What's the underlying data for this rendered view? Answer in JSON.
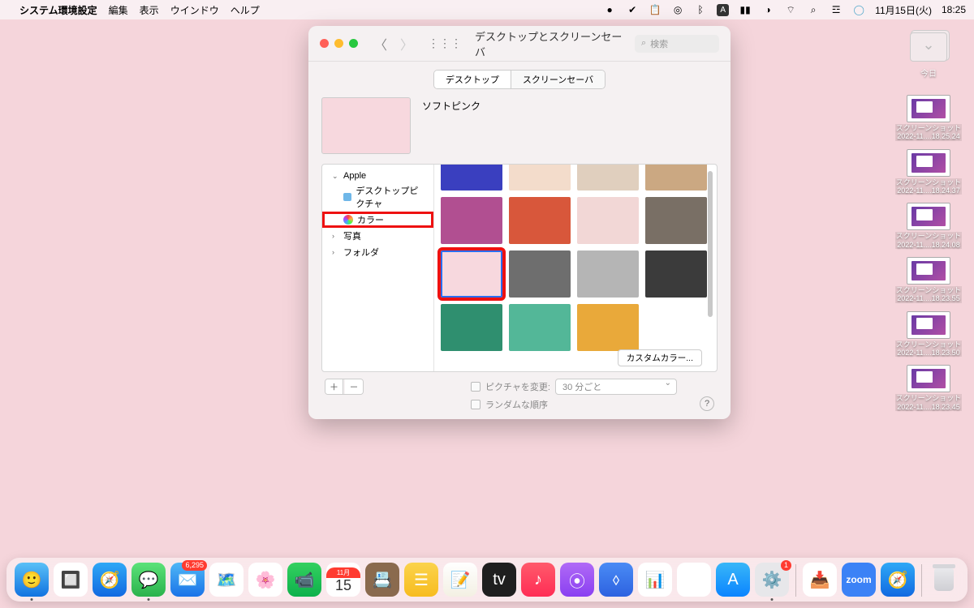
{
  "menubar": {
    "app": "システム環境設定",
    "items": [
      "編集",
      "表示",
      "ウインドウ",
      "ヘルプ"
    ],
    "date": "11月15日(火)",
    "time": "18:25"
  },
  "window": {
    "title": "デスクトップとスクリーンセーバ",
    "search_placeholder": "検索",
    "tabs": {
      "desktop": "デスクトップ",
      "screensaver": "スクリーンセーバ"
    },
    "current_color": "ソフトピンク",
    "sidebar": {
      "apple": "Apple",
      "desktop_pictures": "デスクトップピクチャ",
      "colors": "カラー",
      "photos": "写真",
      "folders": "フォルダ"
    },
    "custom_color": "カスタムカラー...",
    "change_picture": "ピクチャを変更:",
    "interval": "30 分ごと",
    "random": "ランダムな順序"
  },
  "colors": {
    "grid": [
      "#3a3fbf",
      "#f3dccb",
      "#e0cfbe",
      "#cba882",
      "#b14f91",
      "#d8573b",
      "#f2d7d6",
      "#796f65",
      "#f7d8de",
      "#6e6e6e",
      "#b5b5b5",
      "#3b3b3b",
      "#2f8f6f",
      "#53b798",
      "#e9a93a",
      "#ffffff"
    ],
    "selected_index": 8
  },
  "desktop": {
    "stack_label": "今日",
    "shots": [
      {
        "l1": "スクリーンショット",
        "l2": "2022-11....18.25.24"
      },
      {
        "l1": "スクリーンショット",
        "l2": "2022-11....18.24.37"
      },
      {
        "l1": "スクリーンショット",
        "l2": "2022-11....18.24.08"
      },
      {
        "l1": "スクリーンショット",
        "l2": "2022-11....18.23.55"
      },
      {
        "l1": "スクリーンショット",
        "l2": "2022-11....18.23.50"
      },
      {
        "l1": "スクリーンショット",
        "l2": "2022-11....18.23.45"
      }
    ]
  },
  "dock": {
    "mail_badge": "6,295",
    "sys_badge": "1",
    "cal_month": "11月",
    "cal_day": "15",
    "zoom": "zoom"
  }
}
